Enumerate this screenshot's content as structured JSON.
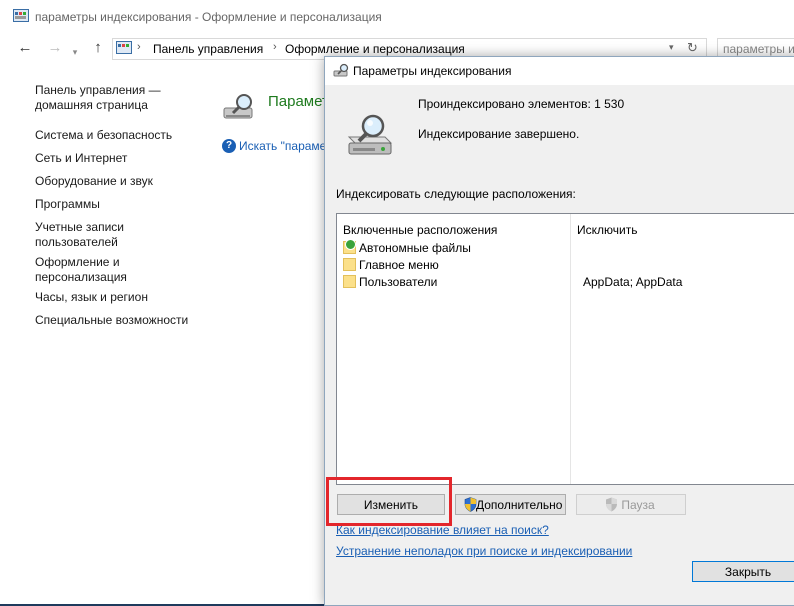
{
  "control_panel": {
    "window_title": "параметры индексирования - Оформление и персонализация",
    "address": {
      "crumb_1": "Панель управления",
      "crumb_2": "Оформление и персонализация",
      "separator": "›"
    },
    "search_placeholder": "параметры инд",
    "nav_links": [
      "Панель управления —",
      "домашняя страница",
      "Система и безопасность",
      "Сеть и Интернет",
      "Оборудование и звук",
      "Программы",
      "Учетные записи",
      "пользователей",
      "Оформление и",
      "персонализация",
      "Часы, язык и регион",
      "Специальные возможности"
    ],
    "main_heading": "Парамет",
    "search_link": "Искать \"парамет"
  },
  "dialog": {
    "title": "Параметры индексирования",
    "indexed_count": "Проиндексировано элементов: 1 530",
    "status": "Индексирование завершено.",
    "locations_label": "Индексировать следующие расположения:",
    "columns": {
      "included": "Включенные расположения",
      "exclude": "Исключить"
    },
    "locations": [
      {
        "name": "Автономные файлы",
        "exclude": ""
      },
      {
        "name": "Главное меню",
        "exclude": ""
      },
      {
        "name": "Пользователи",
        "exclude": "AppData; AppData"
      }
    ],
    "buttons": {
      "modify": "Изменить",
      "advanced": "Дополнительно",
      "pause": "Пауза",
      "close": "Закрыть"
    },
    "links": {
      "how_indexing_affects": "Как индексирование влияет на поиск?",
      "troubleshoot": "Устранение неполадок при поиске и индексировании"
    }
  },
  "colors": {
    "link": "#1a5fb4",
    "heading_green": "#1e7a1e",
    "highlight_red": "#e3262b"
  },
  "icons": [
    "control-panel-icon",
    "back-arrow-icon",
    "forward-arrow-icon",
    "up-arrow-icon",
    "refresh-icon",
    "indexing-icon",
    "help-icon",
    "folder-icon",
    "shield-icon"
  ]
}
